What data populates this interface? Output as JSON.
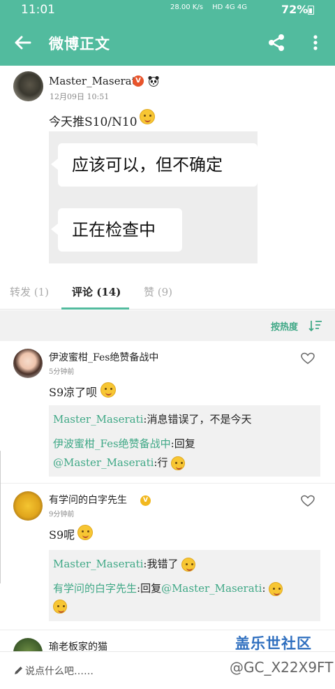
{
  "status_bar": {
    "time": "11:01",
    "network_speed": "28.00 K/s",
    "network_labels": "HD 4G 4G",
    "battery": "72%"
  },
  "appbar": {
    "title": "微博正文",
    "back_icon": "arrow-left-icon",
    "share_icon": "share-icon",
    "more_icon": "more-vertical-icon"
  },
  "post": {
    "author": "Master_Maserati",
    "verified_badge": "V",
    "time": "12月09日 10:51",
    "text": "今天推S10/N10",
    "image": {
      "line1": "应该可以，但不确定",
      "line2": "正在检查中"
    }
  },
  "tabs": {
    "repost": "转发 (1)",
    "comments": "评论 (14)",
    "likes": "赞 (9)"
  },
  "sort": {
    "label": "按热度"
  },
  "comments": [
    {
      "name": "伊波蜜柑_Fes绝赞备战中",
      "time": "5分钟前",
      "text": "S9凉了呗",
      "replies": [
        {
          "author": "Master_Maserati",
          "text": ":消息错误了，不是今天"
        },
        {
          "author": "伊波蜜柑_Fes绝赞备战中",
          "text": ":回复",
          "mention": "@Master_Maserati",
          "tail": ":行"
        }
      ]
    },
    {
      "name": "有学问的白字先生",
      "badge": "V",
      "time": "9分钟前",
      "text": "S9呢",
      "replies": [
        {
          "author": "Master_Maserati",
          "text": ":我错了"
        },
        {
          "author": "有学问的白字先生",
          "text": ":回复",
          "mention": "@Master_Maserati",
          "tail": ":"
        }
      ]
    },
    {
      "name": "瑜老板家的猫"
    }
  ],
  "bottom_bar": {
    "placeholder": "说点什么吧……"
  },
  "watermark": {
    "brand": "盖乐世社区",
    "handle": "@GC_X22X9FT"
  },
  "colors": {
    "primary": "#52bb9e",
    "link": "#3fa886",
    "verified_red": "#e8542b",
    "verified_gold": "#f2b81f"
  }
}
